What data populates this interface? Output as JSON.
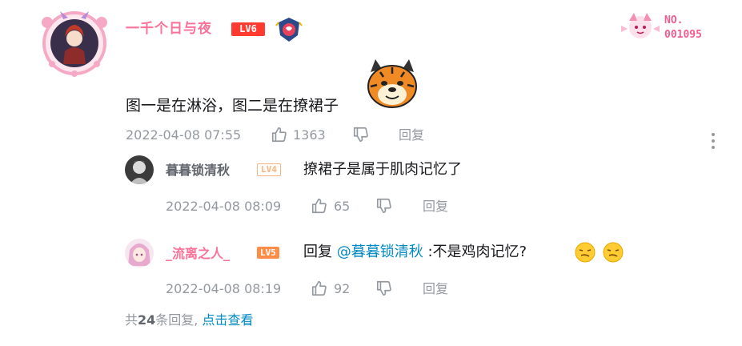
{
  "main_comment": {
    "username": "一千个日与夜",
    "level": "LV6",
    "fan_card": {
      "label": "NO.",
      "number": "001095"
    },
    "content": "图一是在淋浴，图二是在撩裙子",
    "time": "2022-04-08 07:55",
    "likes": "1363",
    "reply_label": "回复"
  },
  "replies": [
    {
      "username": "暮暮锁清秋",
      "level": "LV4",
      "content": "撩裙子是属于肌肉记忆了",
      "time": "2022-04-08 08:09",
      "likes": "65",
      "reply_label": "回复"
    },
    {
      "username": "_流离之人_",
      "level": "LV5",
      "content_prefix": "回复",
      "mention": "@暮暮锁清秋",
      "content_suffix": ":不是鸡肉记忆?",
      "time": "2022-04-08 08:19",
      "likes": "92",
      "reply_label": "回复"
    }
  ],
  "footer": {
    "prefix": "共",
    "count": "24",
    "suffix": "条回复,",
    "view_all": "点击查看"
  },
  "colors": {
    "vip_pink": "#fb7299",
    "meta_gray": "#9499a0",
    "link_blue": "#008ac5",
    "lv6_red": "#ff3b30",
    "lv5_orange": "#ff8c47"
  },
  "icons": [
    "thumbs-up-icon",
    "thumbs-down-icon",
    "more-vertical-icon",
    "tiger-sticker",
    "smirk-emoji",
    "medal-icon"
  ]
}
